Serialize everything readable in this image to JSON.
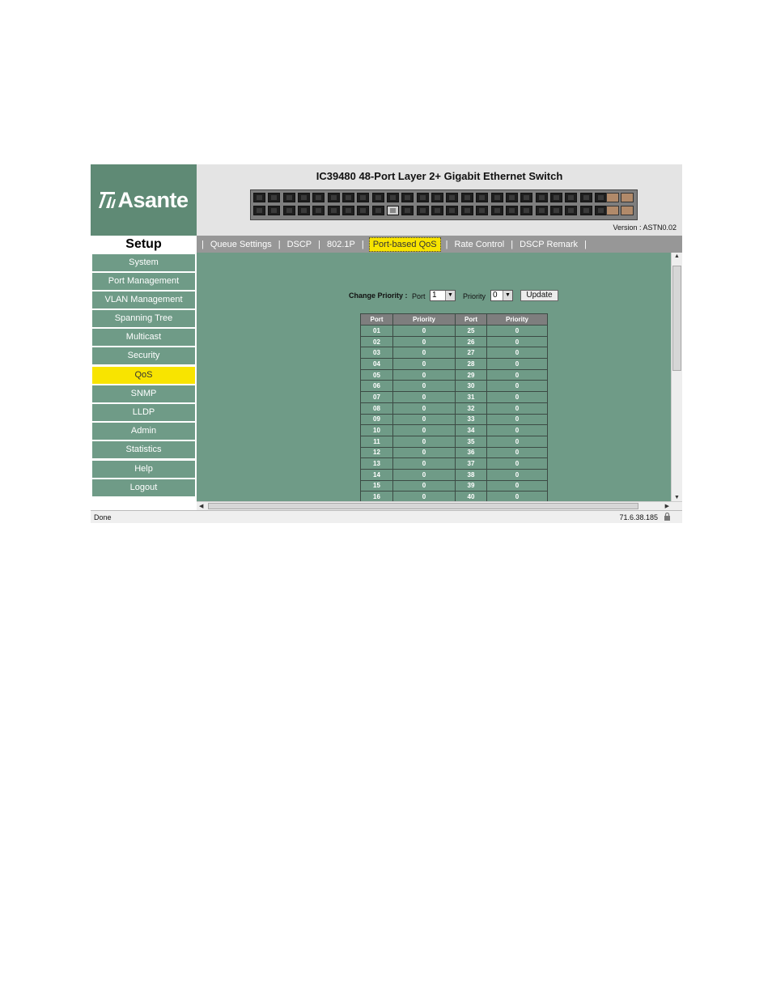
{
  "header": {
    "logo_text": "Asante",
    "device_title": "IC39480 48-Port Layer 2+ Gigabit Ethernet Switch",
    "version": "Version : ASTN0.02"
  },
  "setup_label": "Setup",
  "tabs": [
    {
      "label": "Queue Settings",
      "active": false
    },
    {
      "label": "DSCP",
      "active": false
    },
    {
      "label": "802.1P",
      "active": false
    },
    {
      "label": "Port-based QoS",
      "active": true
    },
    {
      "label": "Rate Control",
      "active": false
    },
    {
      "label": "DSCP Remark",
      "active": false
    }
  ],
  "tab_separator": "|",
  "sidebar": {
    "items": [
      {
        "label": "System",
        "active": false
      },
      {
        "label": "Port Management",
        "active": false
      },
      {
        "label": "VLAN Management",
        "active": false
      },
      {
        "label": "Spanning Tree",
        "active": false
      },
      {
        "label": "Multicast",
        "active": false
      },
      {
        "label": "Security",
        "active": false
      },
      {
        "label": "QoS",
        "active": true
      },
      {
        "label": "SNMP",
        "active": false
      },
      {
        "label": "LLDP",
        "active": false
      },
      {
        "label": "Admin",
        "active": false
      },
      {
        "label": "Statistics",
        "active": false
      },
      {
        "label": "Help",
        "active": false
      },
      {
        "label": "Logout",
        "active": false
      }
    ]
  },
  "change_priority": {
    "label": "Change Priority :",
    "port_label": "Port",
    "port_value": "1",
    "priority_label": "Priority",
    "priority_value": "0",
    "update_label": "Update"
  },
  "table": {
    "headers": [
      "Port",
      "Priority",
      "Port",
      "Priority"
    ],
    "rows": [
      [
        "01",
        "0",
        "25",
        "0"
      ],
      [
        "02",
        "0",
        "26",
        "0"
      ],
      [
        "03",
        "0",
        "27",
        "0"
      ],
      [
        "04",
        "0",
        "28",
        "0"
      ],
      [
        "05",
        "0",
        "29",
        "0"
      ],
      [
        "06",
        "0",
        "30",
        "0"
      ],
      [
        "07",
        "0",
        "31",
        "0"
      ],
      [
        "08",
        "0",
        "32",
        "0"
      ],
      [
        "09",
        "0",
        "33",
        "0"
      ],
      [
        "10",
        "0",
        "34",
        "0"
      ],
      [
        "11",
        "0",
        "35",
        "0"
      ],
      [
        "12",
        "0",
        "36",
        "0"
      ],
      [
        "13",
        "0",
        "37",
        "0"
      ],
      [
        "14",
        "0",
        "38",
        "0"
      ],
      [
        "15",
        "0",
        "39",
        "0"
      ],
      [
        "16",
        "0",
        "40",
        "0"
      ]
    ]
  },
  "statusbar": {
    "text": "Done",
    "ip": "71.6.38.185"
  },
  "colors": {
    "brand_green": "#6f9b87",
    "highlight_yellow": "#f8e400",
    "tab_bar_gray": "#979797"
  },
  "icons": [
    "asante-logo-icon",
    "lock-icon",
    "scroll-up-arrow-icon",
    "scroll-down-arrow-icon",
    "scroll-left-arrow-icon",
    "scroll-right-arrow-icon"
  ]
}
